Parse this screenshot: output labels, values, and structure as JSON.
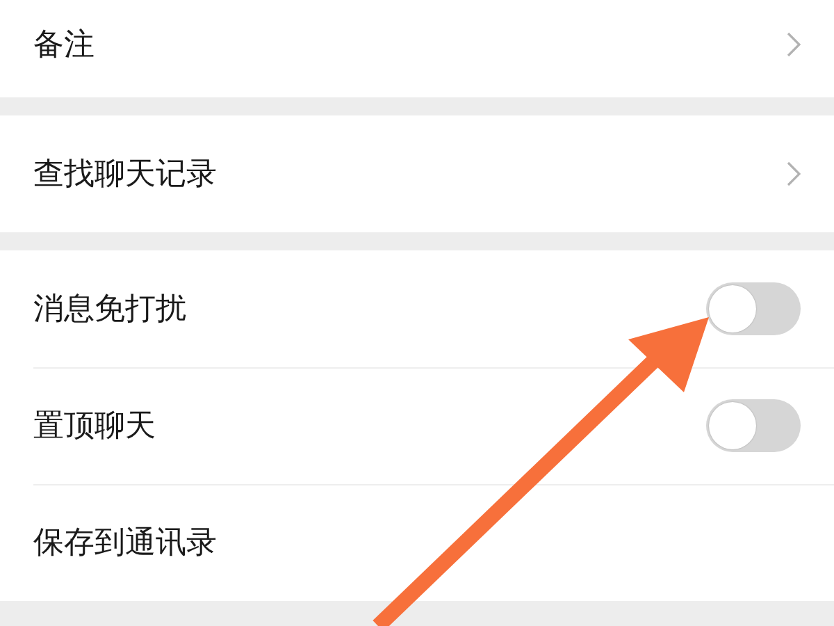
{
  "groups": [
    {
      "items": [
        {
          "kind": "link",
          "label": "备注"
        }
      ]
    },
    {
      "items": [
        {
          "kind": "link",
          "label": "查找聊天记录"
        }
      ]
    },
    {
      "items": [
        {
          "kind": "switch",
          "label": "消息免打扰",
          "on": false
        },
        {
          "kind": "switch",
          "label": "置顶聊天",
          "on": false
        },
        {
          "kind": "plain",
          "label": "保存到通讯录"
        }
      ]
    }
  ],
  "annotation": {
    "kind": "arrow"
  }
}
